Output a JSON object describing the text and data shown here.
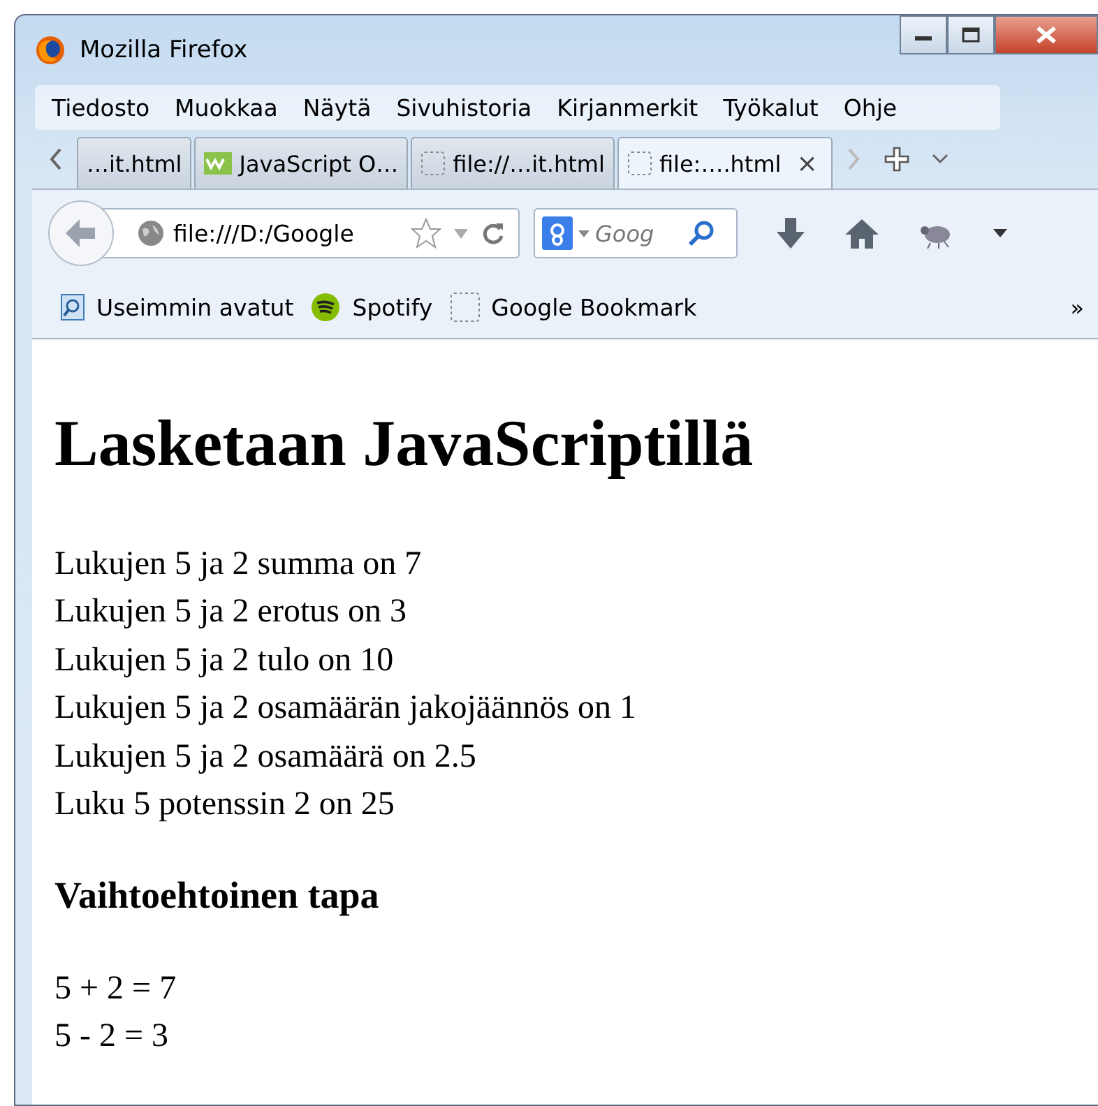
{
  "window": {
    "title": "Mozilla Firefox"
  },
  "menu": [
    "Tiedosto",
    "Muokkaa",
    "Näytä",
    "Sivuhistoria",
    "Kirjanmerkit",
    "Työkalut",
    "Ohje"
  ],
  "tabs": [
    {
      "label": "…it.html",
      "kind": "plain",
      "selected": false
    },
    {
      "label": "JavaScript O…",
      "kind": "w3",
      "selected": false
    },
    {
      "label": "file://…it.html",
      "kind": "blank",
      "selected": false
    },
    {
      "label": "file:….html",
      "kind": "blank",
      "selected": true,
      "close": "×"
    }
  ],
  "address": {
    "value": "file:///D:/Google"
  },
  "search": {
    "placeholder": "Goog"
  },
  "bookmarks": [
    {
      "label": "Useimmin avatut",
      "kind": "recent"
    },
    {
      "label": "Spotify",
      "kind": "spotify"
    },
    {
      "label": "Google Bookmark",
      "kind": "blank"
    }
  ],
  "bookmarks_overflow": "»",
  "page": {
    "heading": "Lasketaan JavaScriptillä",
    "lines": [
      "Lukujen 5 ja 2 summa on 7",
      "Lukujen 5 ja 2 erotus on 3",
      "Lukujen 5 ja 2 tulo on 10",
      "Lukujen 5 ja 2 osamäärän jakojäännös on 1",
      "Lukujen 5 ja 2 osamäärä on 2.5",
      "Luku 5 potenssin 2 on 25"
    ],
    "subheading": "Vaihtoehtoinen tapa",
    "lines2": [
      "5 + 2 = 7",
      "5 - 2 = 3"
    ]
  }
}
